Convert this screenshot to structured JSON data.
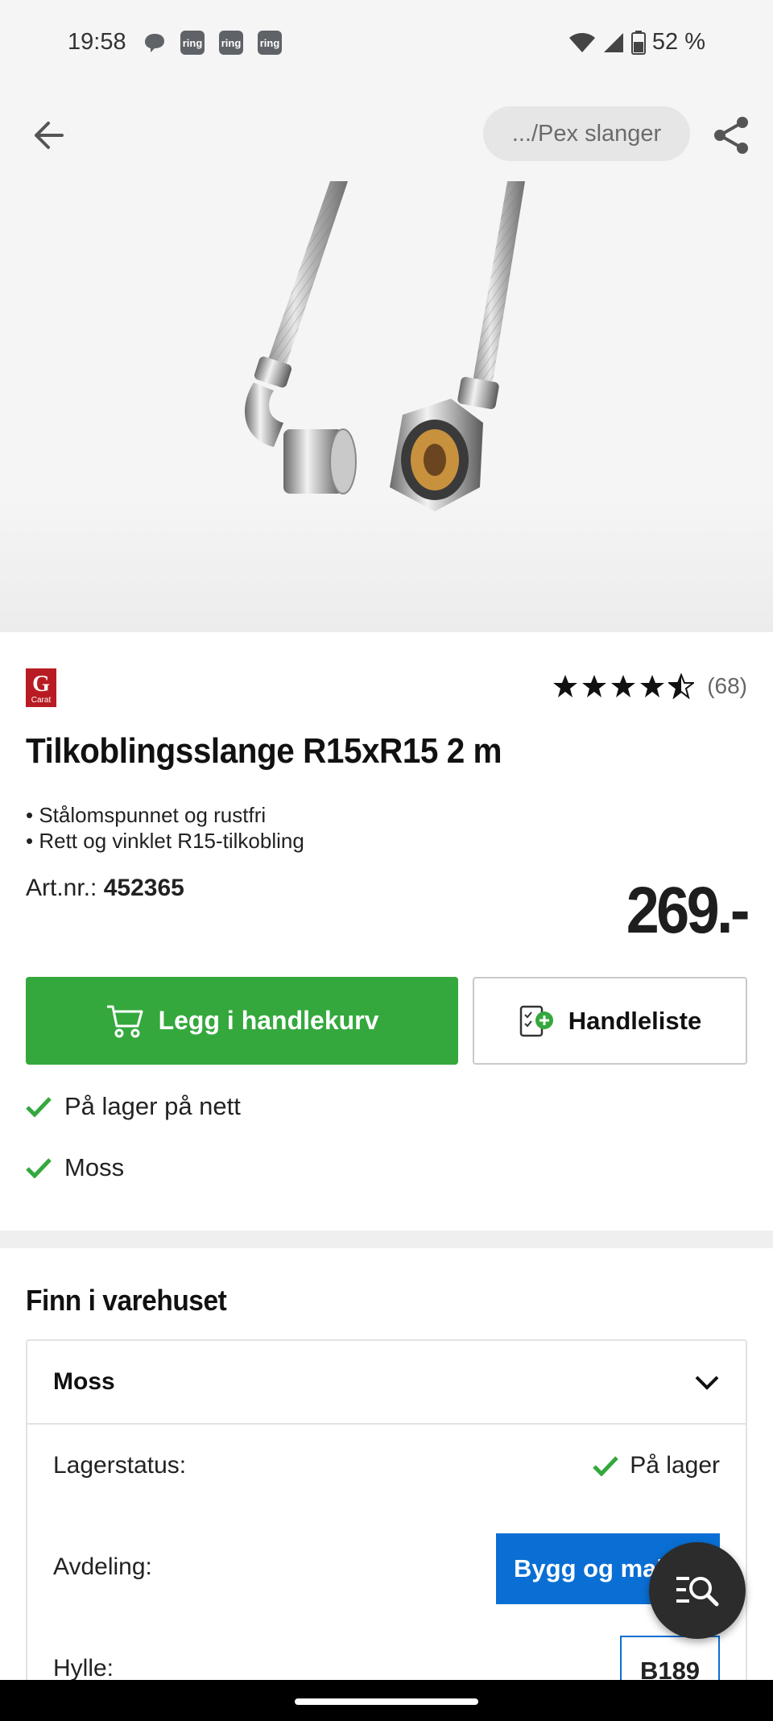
{
  "status_bar": {
    "time": "19:58",
    "notifications": [
      "ring",
      "ring",
      "ring"
    ],
    "battery": "52 %"
  },
  "app_bar": {
    "breadcrumb": ".../Pex slanger"
  },
  "product": {
    "brand": "Carat",
    "rating_count": "(68)",
    "rating_value": 4.5,
    "title": "Tilkoblingsslange R15xR15 2 m",
    "bullets": [
      "• Stålomspunnet og rustfri",
      "• Rett og vinklet R15-tilkobling"
    ],
    "artnr_label": "Art.nr.:",
    "artnr_value": "452365",
    "price": "269.-"
  },
  "actions": {
    "cart_label": "Legg i handlekurv",
    "list_label": "Handleliste"
  },
  "availability": [
    "På lager på nett",
    "Moss"
  ],
  "store_section": {
    "title": "Finn i varehuset",
    "store_name": "Moss",
    "stock_label": "Lagerstatus:",
    "stock_value": "På lager",
    "dept_label": "Avdeling:",
    "dept_value": "Bygg og maling",
    "shelf_label": "Hylle:",
    "shelf_value": "B189"
  },
  "colors": {
    "green": "#34a83d",
    "blue": "#0a6fd4",
    "brand_red": "#b81c22"
  }
}
